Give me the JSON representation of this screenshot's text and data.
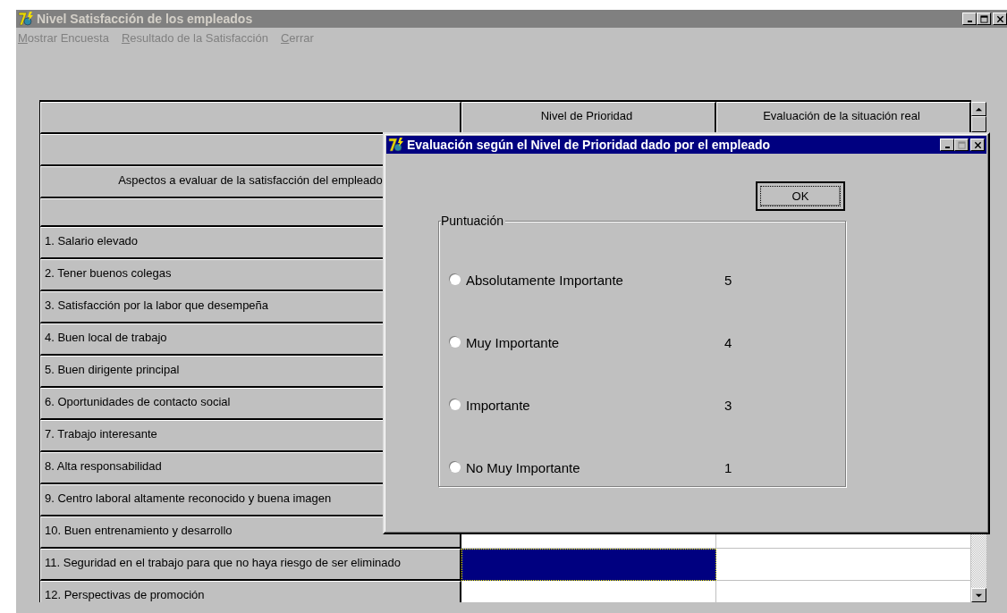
{
  "window": {
    "title": "Nivel Satisfacción de los empleados"
  },
  "menu": [
    {
      "label": "Mostrar Encuesta"
    },
    {
      "label": "Resultado de la Satisfacción"
    },
    {
      "label": "Cerrar"
    }
  ],
  "table": {
    "columns": [
      "Nivel de Prioridad",
      "Evaluación de la situación real"
    ],
    "heading": "Aspectos a evaluar de la satisfacción del empleado",
    "rows": [
      {
        "label": "1. Salario elevado"
      },
      {
        "label": "2. Tener buenos colegas"
      },
      {
        "label": "3. Satisfacción por la labor que desempeña"
      },
      {
        "label": "4. Buen local de trabajo"
      },
      {
        "label": "5. Buen dirigente principal"
      },
      {
        "label": "6. Oportunidades de contacto social"
      },
      {
        "label": "7. Trabajo interesante"
      },
      {
        "label": "8. Alta responsabilidad"
      },
      {
        "label": "9. Centro laboral altamente reconocido y buena imagen"
      },
      {
        "label": "10. Buen entrenamiento y desarrollo",
        "cells": [
          {
            "selected": false
          },
          {
            "selected": false
          }
        ]
      },
      {
        "label": "11. Seguridad en el trabajo para que no haya riesgo de ser eliminado",
        "cells": [
          {
            "selected": true
          },
          {
            "selected": false
          }
        ]
      },
      {
        "label": "12. Perspectivas de promoción",
        "cells": [
          {
            "selected": false
          },
          {
            "selected": false
          }
        ]
      }
    ]
  },
  "dialog": {
    "title": "Evaluación según el Nivel de Prioridad dado por el empleado",
    "ok_button": "OK",
    "group": "Puntuación",
    "options": [
      {
        "label": "Absolutamente Importante",
        "value": "5",
        "selected": false
      },
      {
        "label": "Muy Importante",
        "value": "4",
        "selected": false
      },
      {
        "label": "Importante",
        "value": "3",
        "selected": false
      },
      {
        "label": "No Muy Importante",
        "value": "1",
        "selected": false
      }
    ]
  }
}
